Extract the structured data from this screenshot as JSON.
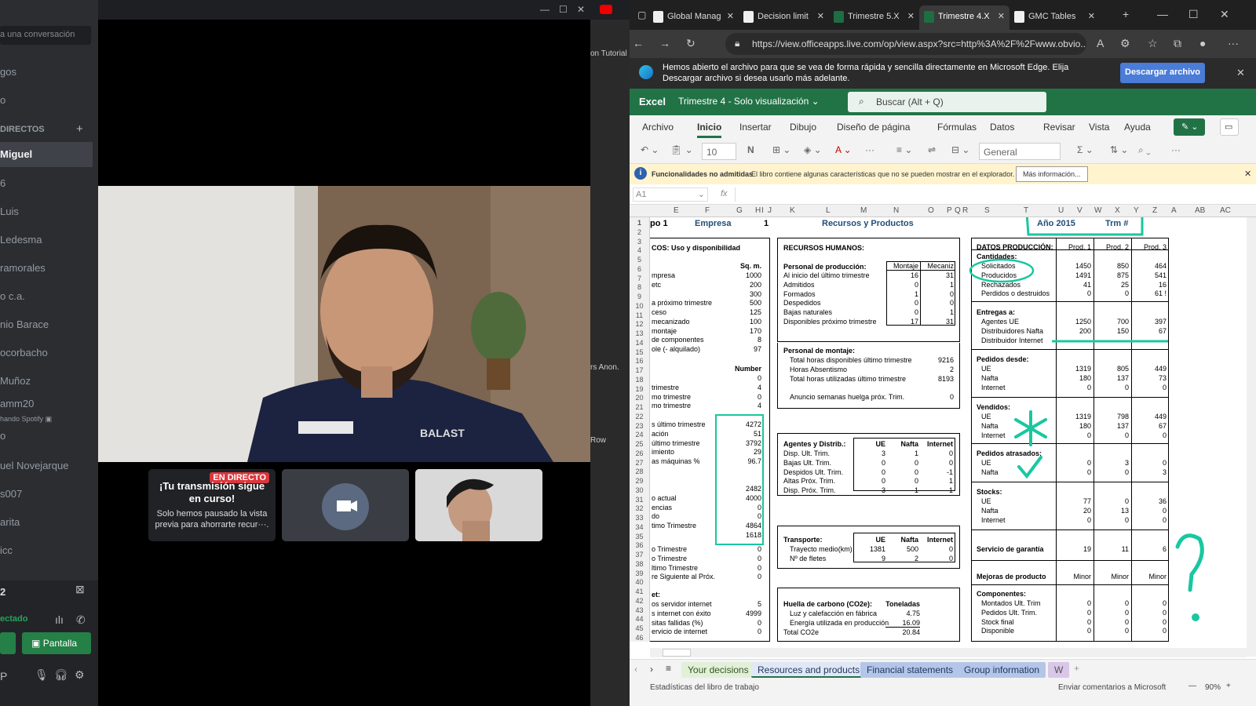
{
  "discord": {
    "search_placeholder": "a una conversación",
    "items_top": [
      "gos",
      "o"
    ],
    "dm_header": "DIRECTOS",
    "dm_plus": "+",
    "active_dm": "Miguel",
    "dms": [
      "6",
      "Luis",
      "Ledesma",
      "ramorales",
      "o c.a.",
      "nio Barace",
      "ocorbacho",
      "Muñoz",
      "amm20",
      "o",
      "uel Novejarque",
      "s007",
      "arita",
      "icc"
    ],
    "dm_sub": "hando Spotify",
    "voice": {
      "room": "2",
      "status": "ectado",
      "screen_label": "Pantalla"
    },
    "live_badge": "EN DIRECTO",
    "live_title": "¡Tu transmisión sigue en curso!",
    "live_text": "Solo hemos pausado la vista previa para ahorrarte recur···.",
    "side_labels": [
      "on Tutorial",
      "rs Anon.",
      "Row"
    ]
  },
  "browser": {
    "tabs": [
      {
        "label": "Global Manag",
        "color": "#f0f0f0"
      },
      {
        "label": "Decision limit",
        "color": "#f0f0f0"
      },
      {
        "label": "Trimestre 5.X",
        "color": "#1d6f42"
      },
      {
        "label": "Trimestre 4.X",
        "color": "#1d6f42",
        "active": true
      },
      {
        "label": "GMC Tables",
        "color": "#f0f0f0"
      }
    ],
    "url": "https://view.officeapps.live.com/op/view.aspx?src=http%3A%2F%2Fwww.obvio...",
    "info_message": "Hemos abierto el archivo para que se vea de forma rápida y sencilla directamente en Microsoft Edge. Elija Descargar archivo si desea usarlo más adelante.",
    "download_label": "Descargar archivo"
  },
  "excel": {
    "app": "Excel",
    "doc_title": "Trimestre 4  -  Solo visualización",
    "search_placeholder": "Buscar (Alt + Q)",
    "ribbon_tabs": [
      "Archivo",
      "Inicio",
      "Insertar",
      "Dibujo",
      "Diseño de página",
      "Fórmulas",
      "Datos",
      "Revisar",
      "Vista",
      "Ayuda"
    ],
    "font_size": "10",
    "number_format": "General",
    "warn_title": "Funcionalidades no admitidas",
    "warn_text": "El libro contiene algunas características que no se pueden mostrar en el explorador.",
    "warn_button": "Más información...",
    "name_box": "A1",
    "fx": "fx",
    "columns": [
      "E",
      "F",
      "G",
      "H",
      "I",
      "J",
      "K",
      "L",
      "M",
      "N",
      "O",
      "P",
      "Q",
      "R",
      "S",
      "T",
      "U",
      "V",
      "W",
      "X",
      "Y",
      "Z",
      "A",
      "AB",
      "AC"
    ],
    "header_row": {
      "grupo": "po",
      "grupo_num": "1",
      "empresa": "Empresa",
      "empresa_num": "1",
      "recursos": "Recursos y Productos",
      "anio": "Año 2015",
      "trm": "Trm #"
    },
    "uso": {
      "title": "COS:  Uso y disponibilidad",
      "unit": "Sq. m.",
      "rows": [
        [
          "mpresa",
          "1000"
        ],
        [
          "etc",
          "200"
        ],
        [
          "",
          "300"
        ],
        [
          "a próximo trimestre",
          "500"
        ],
        [
          "ceso",
          "125"
        ],
        [
          "mecanizado",
          "100"
        ],
        [
          "montaje",
          "170"
        ],
        [
          "de componentes",
          "8"
        ],
        [
          "ole (- alquilado)",
          "97"
        ]
      ],
      "number_label": "Number",
      "rows2": [
        [
          "",
          "0"
        ],
        [
          "trimestre",
          "4"
        ],
        [
          "mo trimestre",
          "0"
        ],
        [
          "mo trimestre",
          "4"
        ]
      ],
      "rows3": [
        [
          "s último trimestre",
          "4272"
        ],
        [
          "ación",
          "51"
        ],
        [
          "último trimestre",
          "3792"
        ],
        [
          "imiento",
          "29"
        ],
        [
          "as máquinas %",
          "96.7"
        ]
      ],
      "rows4": [
        [
          "",
          "2482"
        ],
        [
          "o actual",
          "4000"
        ],
        [
          "encias",
          "0"
        ],
        [
          "do",
          "0"
        ],
        [
          "timo Trimestre",
          "4864"
        ],
        [
          "",
          "1618"
        ]
      ],
      "rows5": [
        [
          "o Trimestre",
          "0"
        ],
        [
          "o Trimestre",
          "0"
        ],
        [
          "ltimo Trimestre",
          "0"
        ],
        [
          "re Siguiente al Próx.",
          "0"
        ]
      ],
      "rows6_title": "et:",
      "rows6": [
        [
          "os servidor internet",
          "5"
        ],
        [
          "s internet con éxito",
          "4999"
        ],
        [
          "sitas fallidas (%)",
          "0"
        ],
        [
          "ervicio de internet",
          "0"
        ]
      ]
    },
    "rrhh": {
      "title": "RECURSOS HUMANOS:",
      "prod_title": "Personal de producción:",
      "col1": "Montaje",
      "col2": "Mecaniz",
      "rows": [
        [
          "Al inicio del último trimestre",
          "16",
          "31"
        ],
        [
          "Admitidos",
          "0",
          "1"
        ],
        [
          "Formados",
          "1",
          "0"
        ],
        [
          "Despedidos",
          "0",
          "0"
        ],
        [
          "Bajas naturales",
          "0",
          "1"
        ],
        [
          "Disponibles próximo trimestre",
          "17",
          "31"
        ]
      ],
      "mont_title": "Personal de montaje:",
      "mont_rows": [
        [
          "Total horas disponibles último trimestre",
          "9216"
        ],
        [
          "Horas Absentismo",
          "2"
        ],
        [
          "Total horas utilizadas último trimestre",
          "8193"
        ]
      ],
      "huelga": [
        "Anuncio semanas huelga próx. Trim.",
        "0"
      ]
    },
    "agentes": {
      "title": "Agentes y Distrib.:",
      "cols": [
        "UE",
        "Nafta",
        "Internet"
      ],
      "rows": [
        [
          "Disp. Ult. Trim.",
          "3",
          "1",
          "0"
        ],
        [
          "Bajas Ult. Trim.",
          "0",
          "0",
          "0"
        ],
        [
          "Despidos Ult. Trim.",
          "0",
          "0",
          "-1"
        ],
        [
          "Altas Próx. Trim.",
          "0",
          "0",
          "1"
        ],
        [
          "Disp. Próx. Trim.",
          "3",
          "1",
          "1"
        ]
      ]
    },
    "transporte": {
      "title": "Transporte:",
      "cols": [
        "UE",
        "Nafta",
        "Internet"
      ],
      "rows": [
        [
          "Trayecto medio(km)",
          "1381",
          "500",
          "0"
        ],
        [
          "Nº de fletes",
          "9",
          "2",
          "0"
        ]
      ]
    },
    "huella": {
      "title": "Huella de carbono (CO2e):",
      "unit": "Toneladas",
      "rows": [
        [
          "Luz y calefacción en fábrica",
          "4.75"
        ],
        [
          "Energía utilizada en producción",
          "16.09"
        ],
        [
          "Total CO2e",
          "20.84"
        ]
      ]
    },
    "produccion": {
      "title": "DATOS PRODUCCIÓN:",
      "cols": [
        "Prod. 1",
        "Prod. 2",
        "Prod. 3"
      ],
      "cantidades": "Cantidades:",
      "c_rows": [
        [
          "Solicitados",
          "1450",
          "850",
          "464"
        ],
        [
          "Producidos",
          "1491",
          "875",
          "541"
        ],
        [
          "Rechazados",
          "41",
          "25",
          "16"
        ],
        [
          "Perdidos o destruidos",
          "0",
          "0",
          "61 !"
        ]
      ],
      "entregas": "Entregas a:",
      "e_rows": [
        [
          "Agentes UE",
          "1250",
          "700",
          "397"
        ],
        [
          "Distribuidores Nafta",
          "200",
          "150",
          "67"
        ],
        [
          "Distribuidor Internet",
          "",
          "",
          ""
        ]
      ],
      "pedidos": "Pedidos desde:",
      "p_rows": [
        [
          "UE",
          "1319",
          "805",
          "449"
        ],
        [
          "Nafta",
          "180",
          "137",
          "73"
        ],
        [
          "Internet",
          "0",
          "0",
          "0"
        ]
      ],
      "vendidos": "Vendidos:",
      "v_rows": [
        [
          "UE",
          "1319",
          "798",
          "449"
        ],
        [
          "Nafta",
          "180",
          "137",
          "67"
        ],
        [
          "Internet",
          "0",
          "0",
          "0"
        ]
      ],
      "atrasados": "Pedidos atrasados:",
      "a_rows": [
        [
          "UE",
          "0",
          "3",
          "0"
        ],
        [
          "Nafta",
          "0",
          "0",
          "3"
        ]
      ],
      "stocks": "Stocks:",
      "s_rows": [
        [
          "UE",
          "77",
          "0",
          "36"
        ],
        [
          "Nafta",
          "20",
          "13",
          "0"
        ],
        [
          "Internet",
          "0",
          "0",
          "0"
        ]
      ],
      "garantia": [
        "Servicio de garantía",
        "19",
        "11",
        "6"
      ],
      "mejoras": [
        "Mejoras de producto",
        "Minor",
        "Minor",
        "Minor"
      ],
      "componentes": "Componentes:",
      "comp_rows": [
        [
          "Montados Ult. Trim",
          "0",
          "0",
          "0"
        ],
        [
          "Pedidos Ult. Trim.",
          "0",
          "0",
          "0"
        ],
        [
          "Stock final",
          "0",
          "0",
          "0"
        ],
        [
          "Disponible",
          "0",
          "0",
          "0"
        ]
      ]
    },
    "sheet_tabs": [
      "Your decisions",
      "Resources and products",
      "Financial statements",
      "Group information",
      "W"
    ],
    "status_left": "Estadísticas del libro de trabajo",
    "status_right": "Enviar comentarios a Microsoft",
    "zoom": "90%"
  }
}
